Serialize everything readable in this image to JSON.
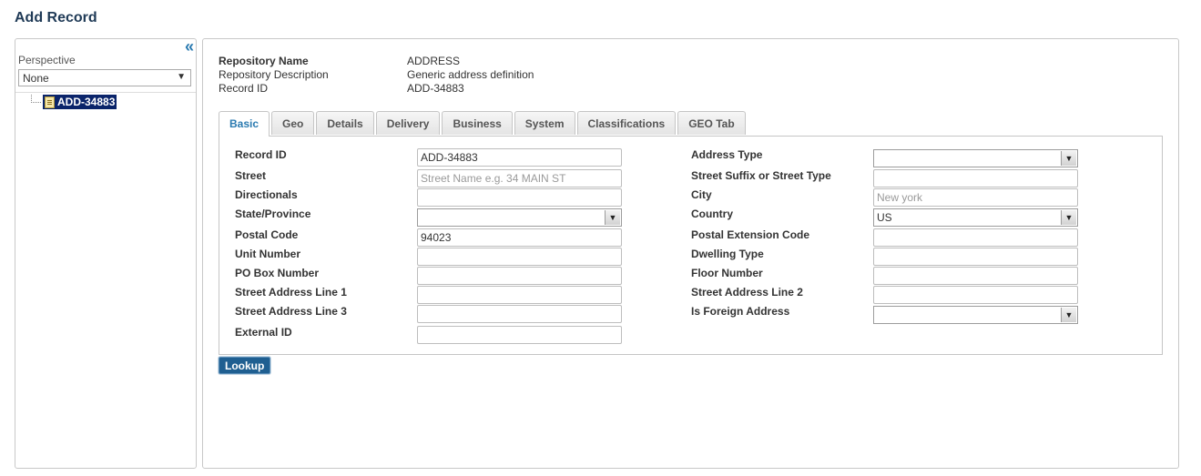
{
  "page_title": "Add Record",
  "left_panel": {
    "collapse_icon": "double-chevron-left-icon",
    "perspective_label": "Perspective",
    "perspective_value": "None",
    "tree_selected": "ADD-34883"
  },
  "meta": [
    {
      "key": "Repository Name",
      "value": "ADDRESS"
    },
    {
      "key": "Repository Description",
      "value": "Generic address definition"
    },
    {
      "key": "Record ID",
      "value": "ADD-34883"
    }
  ],
  "tabs": [
    "Basic",
    "Geo",
    "Details",
    "Delivery",
    "Business",
    "System",
    "Classifications",
    "GEO Tab"
  ],
  "active_tab": "Basic",
  "form_left": [
    {
      "label": "Record ID",
      "value": "ADD-34883",
      "placeholder": "",
      "type": "text"
    },
    {
      "label": "Street",
      "value": "",
      "placeholder": "Street Name e.g. 34 MAIN ST",
      "type": "text"
    },
    {
      "label": "Directionals",
      "value": "",
      "placeholder": "",
      "type": "text"
    },
    {
      "label": "State/Province",
      "value": "",
      "placeholder": "",
      "type": "select"
    },
    {
      "label": "Postal Code",
      "value": "94023",
      "placeholder": "",
      "type": "text"
    },
    {
      "label": "Unit Number",
      "value": "",
      "placeholder": "",
      "type": "text"
    },
    {
      "label": "PO Box Number",
      "value": "",
      "placeholder": "",
      "type": "text"
    },
    {
      "label": "Street Address Line 1",
      "value": "",
      "placeholder": "",
      "type": "text"
    },
    {
      "label": "Street Address Line 3",
      "value": "",
      "placeholder": "",
      "type": "text"
    },
    {
      "label": "External ID",
      "value": "",
      "placeholder": "",
      "type": "text"
    }
  ],
  "form_right": [
    {
      "label": "Address Type",
      "value": "",
      "placeholder": "",
      "type": "select"
    },
    {
      "label": "Street Suffix or Street Type",
      "value": "",
      "placeholder": "",
      "type": "text"
    },
    {
      "label": "City",
      "value": "",
      "placeholder": "New york",
      "type": "text"
    },
    {
      "label": "Country",
      "value": "US",
      "placeholder": "",
      "type": "select"
    },
    {
      "label": "Postal Extension Code",
      "value": "",
      "placeholder": "",
      "type": "text"
    },
    {
      "label": "Dwelling Type",
      "value": "",
      "placeholder": "",
      "type": "text"
    },
    {
      "label": "Floor Number",
      "value": "",
      "placeholder": "",
      "type": "text"
    },
    {
      "label": "Street Address Line 2",
      "value": "",
      "placeholder": "",
      "type": "text"
    },
    {
      "label": "Is Foreign Address",
      "value": "",
      "placeholder": "",
      "type": "select"
    }
  ],
  "lookup_button": "Lookup"
}
